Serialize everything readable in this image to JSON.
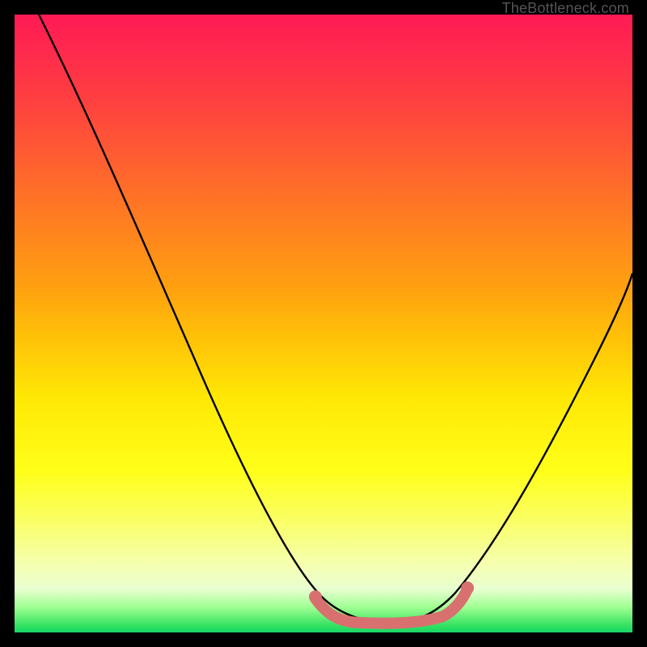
{
  "watermark": "TheBottleneck.com",
  "colors": {
    "frame": "#000000",
    "curve": "#000000",
    "marker": "#d87070",
    "gradient_top": "#ff1a55",
    "gradient_bottom": "#18d868"
  },
  "chart_data": {
    "type": "line",
    "title": "",
    "xlabel": "",
    "ylabel": "",
    "xlim": [
      0,
      100
    ],
    "ylim": [
      0,
      100
    ],
    "series": [
      {
        "name": "curve",
        "x": [
          4,
          10,
          18,
          26,
          34,
          42,
          48,
          52,
          56,
          60,
          64,
          68,
          72,
          78,
          84,
          90,
          96,
          100
        ],
        "values": [
          100,
          87,
          72,
          56,
          41,
          27,
          15,
          8,
          4,
          2,
          2,
          3,
          5,
          11,
          22,
          36,
          50,
          60
        ]
      },
      {
        "name": "highlight-segment",
        "x": [
          48,
          52,
          56,
          60,
          64,
          68,
          71
        ],
        "values": [
          5,
          3,
          2,
          1.5,
          1.5,
          2.5,
          4
        ]
      }
    ],
    "annotations": []
  }
}
